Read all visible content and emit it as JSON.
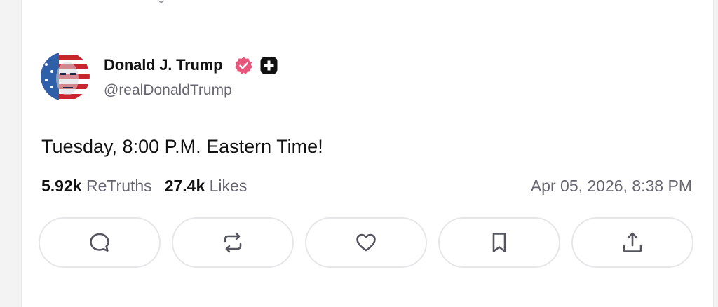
{
  "post": {
    "author": {
      "display_name": "Donald J. Trump",
      "handle": "@realDonaldTrump",
      "avatar_icon": "avatar-flag-portrait",
      "verified_icon": "verified-badge-icon",
      "plus_icon": "plus-badge-icon"
    },
    "text": "Tuesday, 8:00 P.M. Eastern Time!",
    "stats": {
      "retruths_count": "5.92k",
      "retruths_label": "ReTruths",
      "likes_count": "27.4k",
      "likes_label": "Likes"
    },
    "timestamp": "Apr 05, 2026, 8:38 PM"
  },
  "actions": [
    {
      "name": "reply",
      "icon": "reply-icon"
    },
    {
      "name": "retruth",
      "icon": "retruth-icon"
    },
    {
      "name": "like",
      "icon": "heart-icon"
    },
    {
      "name": "bookmark",
      "icon": "bookmark-icon"
    },
    {
      "name": "share",
      "icon": "share-icon"
    }
  ],
  "colors": {
    "verified_badge": "#e8557a",
    "text_primary": "#111111",
    "text_secondary": "#666670",
    "border": "#e7e7ea"
  }
}
